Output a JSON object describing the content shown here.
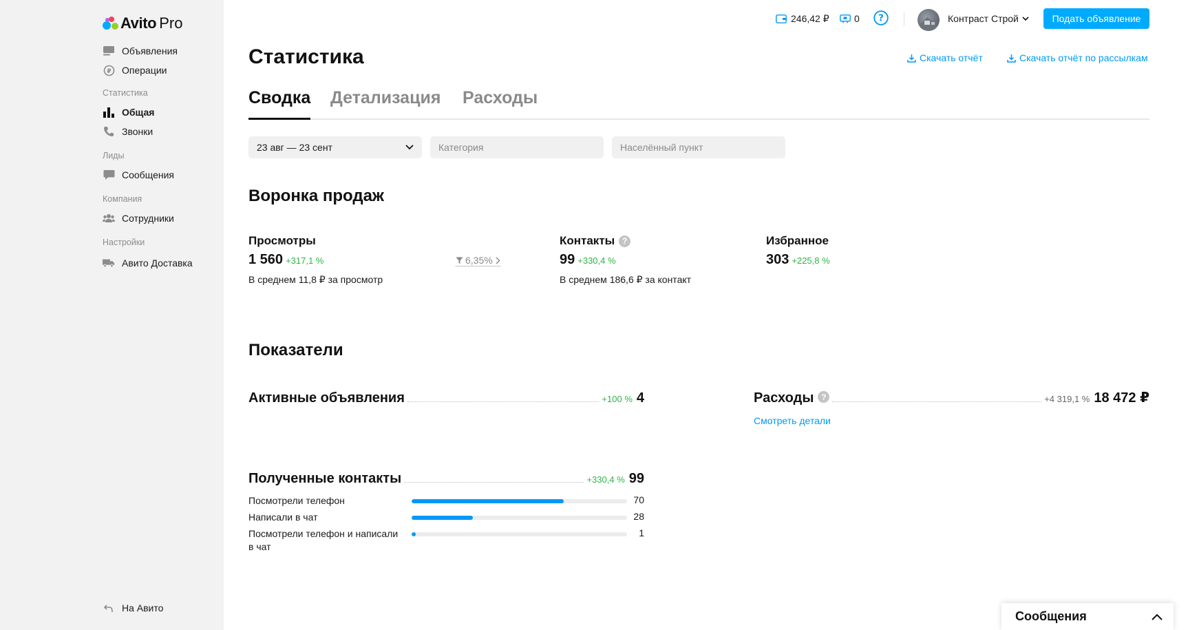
{
  "sidebar": {
    "logo_main": "Avito",
    "logo_pro": "Pro",
    "items": [
      {
        "label": "Объявления",
        "icon": "listing-icon"
      },
      {
        "label": "Операции",
        "icon": "operations-icon"
      }
    ],
    "sections": {
      "statistics": "Статистика",
      "leads": "Лиды",
      "company": "Компания",
      "settings": "Настройки"
    },
    "stats_items": [
      {
        "label": "Общая",
        "icon": "bar-chart-icon",
        "active": true
      },
      {
        "label": "Звонки",
        "icon": "phone-icon"
      }
    ],
    "leads_items": [
      {
        "label": "Сообщения",
        "icon": "chat-icon"
      }
    ],
    "company_items": [
      {
        "label": "Сотрудники",
        "icon": "users-icon"
      }
    ],
    "settings_items": [
      {
        "label": "Авито Доставка",
        "icon": "truck-icon"
      }
    ],
    "back_link": "На Авито"
  },
  "header": {
    "balance": "246,42 ₽",
    "promo_count": "0",
    "account_name": "Контраст Строй",
    "post_button": "Подать объявление"
  },
  "page": {
    "title": "Статистика",
    "download_report": "Скачать отчёт",
    "download_mailing_report": "Скачать отчёт по рассылкам",
    "tabs": [
      "Сводка",
      "Детализация",
      "Расходы"
    ],
    "filters": {
      "period": "23 авг — 23 сент",
      "category_placeholder": "Категория",
      "city_placeholder": "Населённый пункт"
    }
  },
  "funnel": {
    "title": "Воронка продаж",
    "views": {
      "label": "Просмотры",
      "value": "1 560",
      "delta": "+317,1 %",
      "sub": "В среднем 11,8 ₽ за просмотр"
    },
    "conversion": "6,35%",
    "contacts": {
      "label": "Контакты",
      "value": "99",
      "delta": "+330,4 %",
      "sub": "В среднем 186,6 ₽ за контакт"
    },
    "favorites": {
      "label": "Избранное",
      "value": "303",
      "delta": "+225,8 %"
    }
  },
  "indicators": {
    "title": "Показатели",
    "active_ads": {
      "label": "Активные объявления",
      "delta": "+100 %",
      "value": "4"
    },
    "expenses": {
      "label": "Расходы",
      "delta": "+4 319,1 %",
      "value": "18 472 ₽",
      "details_link": "Смотреть детали"
    },
    "contacts": {
      "label": "Полученные контакты",
      "delta": "+330,4 %",
      "value": "99",
      "breakdown": [
        {
          "label": "Посмотрели телефон",
          "value": "70",
          "share": 0.707
        },
        {
          "label": "Написали в чат",
          "value": "28",
          "share": 0.283
        },
        {
          "label": "Посмотрели телефон и написали в чат",
          "value": "1",
          "share": 0.01
        }
      ]
    }
  },
  "messages_panel": {
    "title": "Сообщения"
  },
  "colors": {
    "accent": "#00aaff",
    "link": "#0099f7",
    "positive": "#2fb545",
    "sidebar_bg": "#f2f2f2"
  }
}
